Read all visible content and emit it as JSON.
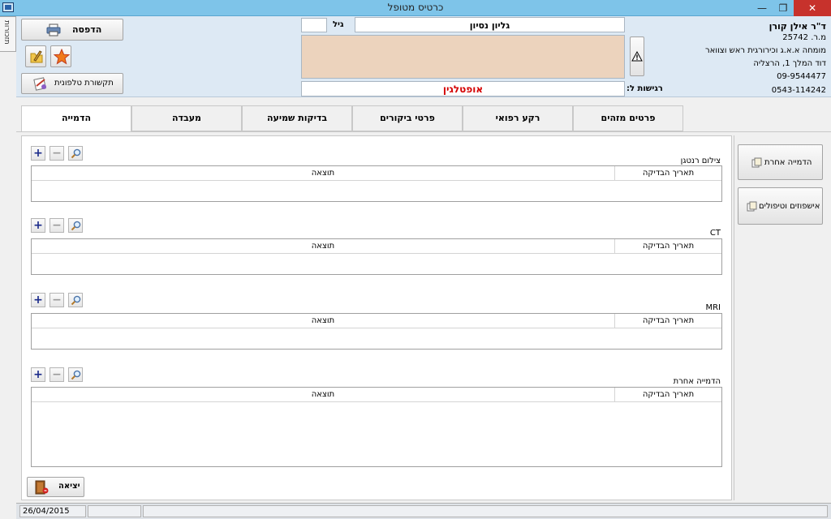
{
  "window": {
    "title": "כרטיס מטופל",
    "restore": "❐",
    "minimize": "—",
    "close": "✕"
  },
  "side_tab": {
    "label": "תזכורות"
  },
  "toolbar": {
    "print_label": "הדפסה",
    "phone_label": "תקשורת טלפונית"
  },
  "doctor": {
    "name": "ד\"ר אילן קורן",
    "license": "מ.ר. 25742",
    "specialty": "מומחה א.א.ג וכירורגית ראש וצוואר",
    "address": "דוד המלך 1, הרצליה",
    "phone1": "09-9544477",
    "phone2": "0543-114242"
  },
  "patient": {
    "name": "גליון נסיון",
    "age_label": "גיל",
    "age": "",
    "sensitivity_label": "רגישות ל:",
    "sensitivity": "אופטלגין",
    "note": ""
  },
  "tabs": [
    {
      "label": "הדמייה"
    },
    {
      "label": "מעבדה"
    },
    {
      "label": "בדיקות שמיעה"
    },
    {
      "label": "פרטי ביקורים"
    },
    {
      "label": "רקע רפואי"
    },
    {
      "label": "פרטים מזהים"
    }
  ],
  "sections": [
    {
      "title": "צילום רנטגן",
      "col_date": "תאריך הבדיקה",
      "col_result": "תוצאה"
    },
    {
      "title": "CT",
      "col_date": "תאריך הבדיקה",
      "col_result": "תוצאה"
    },
    {
      "title": "MRI",
      "col_date": "תאריך הבדיקה",
      "col_result": "תוצאה"
    },
    {
      "title": "הדמייה אחרת",
      "col_date": "תאריך הבדיקה",
      "col_result": "תוצאה"
    }
  ],
  "mini_buttons": {
    "add": "+",
    "remove": "−"
  },
  "right_buttons": [
    {
      "label": "הדמייה אחרת"
    },
    {
      "label": "אישפוזים וטיפולים"
    }
  ],
  "exit_label": "יציאה",
  "status": {
    "date": "26/04/2015"
  },
  "colors": {
    "titlebar": "#7ec4e9",
    "header": "#dde9f4",
    "note_bg": "#ecd3bd",
    "sensitivity_text": "#d40000",
    "plus": "#1a2a8a"
  }
}
